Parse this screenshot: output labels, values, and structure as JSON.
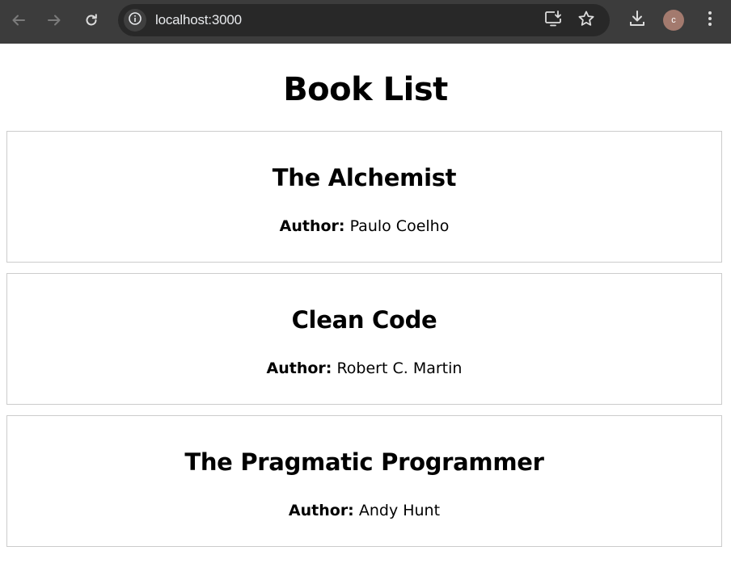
{
  "browser": {
    "url": "localhost:3000",
    "avatar_initial": "c",
    "avatar_color": "#a37a6e",
    "toolbar_color": "#3c3c3c",
    "omnibox_color": "#282828",
    "icons": [
      "back-arrow-icon",
      "forward-arrow-icon",
      "reload-icon",
      "site-info-icon",
      "install-app-icon",
      "bookmark-star-icon",
      "download-icon",
      "more-menu-icon"
    ]
  },
  "page": {
    "title": "Book List",
    "author_label": "Author:",
    "books": [
      {
        "title": "The Alchemist",
        "author": "Paulo Coelho"
      },
      {
        "title": "Clean Code",
        "author": "Robert C. Martin"
      },
      {
        "title": "The Pragmatic Programmer",
        "author": "Andy Hunt"
      }
    ]
  }
}
